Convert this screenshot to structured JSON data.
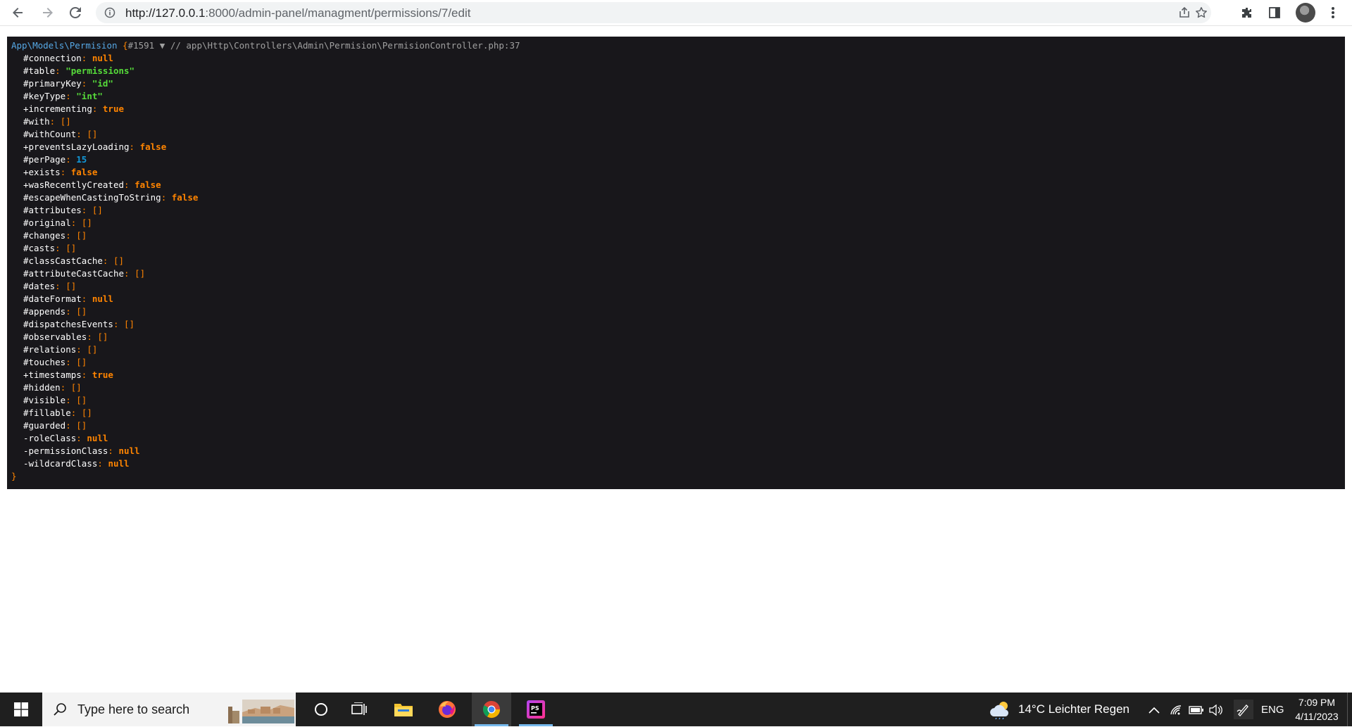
{
  "browser": {
    "url_scheme_host": "http://127.0.0.1",
    "url_rest": ":8000/admin-panel/managment/permissions/7/edit",
    "icons": [
      "back-icon",
      "forward-icon",
      "reload-icon",
      "site-info-icon",
      "share-icon",
      "bookmark-star-icon",
      "extensions-icon",
      "side-panel-icon",
      "profile-avatar",
      "menu-kebab-icon"
    ]
  },
  "dump": {
    "class_name": "App\\Models\\Permision",
    "open_brace": "{",
    "object_id": "#1591",
    "toggle": "▼",
    "comment": "// app\\Http\\Controllers\\Admin\\Permision\\PermisionController.php:37",
    "close_brace": "}",
    "properties": [
      {
        "mod": "#",
        "key": "connection",
        "value": "null",
        "type": "const"
      },
      {
        "mod": "#",
        "key": "table",
        "value": "\"permissions\"",
        "type": "str"
      },
      {
        "mod": "#",
        "key": "primaryKey",
        "value": "\"id\"",
        "type": "str"
      },
      {
        "mod": "#",
        "key": "keyType",
        "value": "\"int\"",
        "type": "str"
      },
      {
        "mod": "+",
        "key": "incrementing",
        "value": "true",
        "type": "const"
      },
      {
        "mod": "#",
        "key": "with",
        "value": "[]",
        "type": "arr"
      },
      {
        "mod": "#",
        "key": "withCount",
        "value": "[]",
        "type": "arr"
      },
      {
        "mod": "+",
        "key": "preventsLazyLoading",
        "value": "false",
        "type": "const"
      },
      {
        "mod": "#",
        "key": "perPage",
        "value": "15",
        "type": "num"
      },
      {
        "mod": "+",
        "key": "exists",
        "value": "false",
        "type": "const"
      },
      {
        "mod": "+",
        "key": "wasRecentlyCreated",
        "value": "false",
        "type": "const"
      },
      {
        "mod": "#",
        "key": "escapeWhenCastingToString",
        "value": "false",
        "type": "const"
      },
      {
        "mod": "#",
        "key": "attributes",
        "value": "[]",
        "type": "arr"
      },
      {
        "mod": "#",
        "key": "original",
        "value": "[]",
        "type": "arr"
      },
      {
        "mod": "#",
        "key": "changes",
        "value": "[]",
        "type": "arr"
      },
      {
        "mod": "#",
        "key": "casts",
        "value": "[]",
        "type": "arr"
      },
      {
        "mod": "#",
        "key": "classCastCache",
        "value": "[]",
        "type": "arr"
      },
      {
        "mod": "#",
        "key": "attributeCastCache",
        "value": "[]",
        "type": "arr"
      },
      {
        "mod": "#",
        "key": "dates",
        "value": "[]",
        "type": "arr"
      },
      {
        "mod": "#",
        "key": "dateFormat",
        "value": "null",
        "type": "const"
      },
      {
        "mod": "#",
        "key": "appends",
        "value": "[]",
        "type": "arr"
      },
      {
        "mod": "#",
        "key": "dispatchesEvents",
        "value": "[]",
        "type": "arr"
      },
      {
        "mod": "#",
        "key": "observables",
        "value": "[]",
        "type": "arr"
      },
      {
        "mod": "#",
        "key": "relations",
        "value": "[]",
        "type": "arr"
      },
      {
        "mod": "#",
        "key": "touches",
        "value": "[]",
        "type": "arr"
      },
      {
        "mod": "+",
        "key": "timestamps",
        "value": "true",
        "type": "const"
      },
      {
        "mod": "#",
        "key": "hidden",
        "value": "[]",
        "type": "arr"
      },
      {
        "mod": "#",
        "key": "visible",
        "value": "[]",
        "type": "arr"
      },
      {
        "mod": "#",
        "key": "fillable",
        "value": "[]",
        "type": "arr"
      },
      {
        "mod": "#",
        "key": "guarded",
        "value": "[]",
        "type": "arr"
      },
      {
        "mod": "-",
        "key": "roleClass",
        "value": "null",
        "type": "const"
      },
      {
        "mod": "-",
        "key": "permissionClass",
        "value": "null",
        "type": "const"
      },
      {
        "mod": "-",
        "key": "wildcardClass",
        "value": "null",
        "type": "const"
      }
    ]
  },
  "taskbar": {
    "search_placeholder": "Type here to search",
    "apps": [
      "start-windows-icon",
      "cortana-circle-icon",
      "task-view-icon",
      "file-explorer-icon",
      "firefox-icon",
      "chrome-icon",
      "phpstorm-icon"
    ],
    "weather": "14°C  Leichter Regen",
    "language": "ENG",
    "time": "7:09 PM",
    "date": "4/11/2023"
  },
  "colors": {
    "dump_bg": "#18171b",
    "class": "#56a8e5",
    "string": "#56db3a",
    "keyword": "#ff8400",
    "number": "#1299da",
    "taskbar_bg": "#1f1f1f"
  }
}
